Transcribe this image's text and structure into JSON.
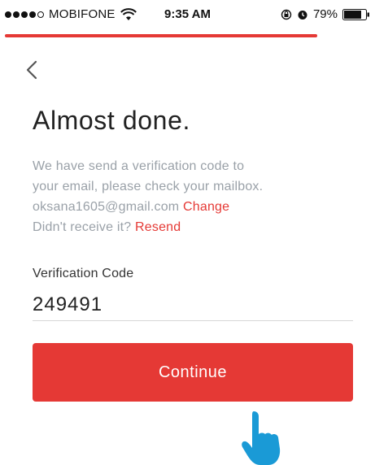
{
  "status_bar": {
    "carrier": "MOBIFONE",
    "time": "9:35 AM",
    "battery": "79%"
  },
  "icons": {
    "back": "chevron-left-icon",
    "wifi": "wifi-icon",
    "rotation_lock": "rotation-lock-icon",
    "alarm": "alarm-icon",
    "battery": "battery-icon",
    "cursor": "hand-pointer-icon"
  },
  "colors": {
    "accent": "#e53935",
    "muted_text": "#9aa1a8",
    "title_text": "#222222"
  },
  "page": {
    "title": "Almost done.",
    "message_line1": "We have send a verification code to",
    "message_line2": "your email, please check your mailbox.",
    "email": "oksana1605@gmail.com",
    "change_link": "Change",
    "not_received": "Didn't receive it?",
    "resend_link": "Resend"
  },
  "form": {
    "code_label": "Verification Code",
    "code_value": "249491",
    "continue_label": "Continue"
  }
}
